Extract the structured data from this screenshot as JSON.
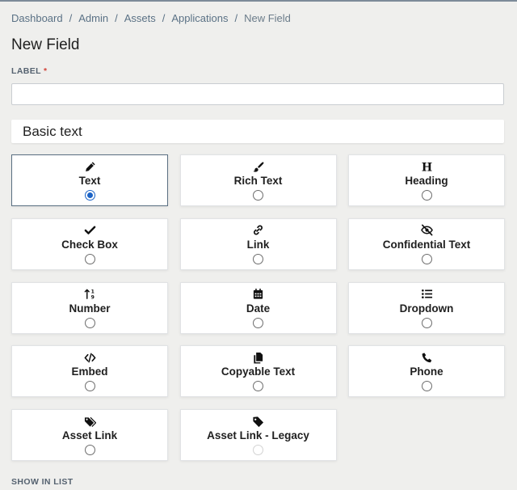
{
  "breadcrumb": {
    "items": [
      "Dashboard",
      "Admin",
      "Assets",
      "Applications"
    ],
    "current": "New Field",
    "separator": "/"
  },
  "page": {
    "title": "New Field"
  },
  "label_field": {
    "label": "LABEL",
    "required_mark": "*",
    "value": ""
  },
  "section": {
    "title": "Basic text"
  },
  "field_types": [
    {
      "label": "Text",
      "icon": "pencil-icon",
      "selected": true,
      "disabled": false
    },
    {
      "label": "Rich Text",
      "icon": "brush-icon",
      "selected": false,
      "disabled": false
    },
    {
      "label": "Heading",
      "icon": "heading-icon",
      "selected": false,
      "disabled": false
    },
    {
      "label": "Check Box",
      "icon": "checkmark-icon",
      "selected": false,
      "disabled": false
    },
    {
      "label": "Link",
      "icon": "link-icon",
      "selected": false,
      "disabled": false
    },
    {
      "label": "Confidential Text",
      "icon": "eye-slash-icon",
      "selected": false,
      "disabled": false
    },
    {
      "label": "Number",
      "icon": "sort-numeric-icon",
      "selected": false,
      "disabled": false
    },
    {
      "label": "Date",
      "icon": "calendar-icon",
      "selected": false,
      "disabled": false
    },
    {
      "label": "Dropdown",
      "icon": "list-icon",
      "selected": false,
      "disabled": false
    },
    {
      "label": "Embed",
      "icon": "code-icon",
      "selected": false,
      "disabled": false
    },
    {
      "label": "Copyable Text",
      "icon": "copy-icon",
      "selected": false,
      "disabled": false
    },
    {
      "label": "Phone",
      "icon": "phone-icon",
      "selected": false,
      "disabled": false
    },
    {
      "label": "Asset Link",
      "icon": "tags-icon",
      "selected": false,
      "disabled": false
    },
    {
      "label": "Asset Link - Legacy",
      "icon": "tag-icon",
      "selected": false,
      "disabled": true
    }
  ],
  "show_in_list": {
    "label": "SHOW IN LIST"
  },
  "colors": {
    "background": "#efefed",
    "breadcrumb": "#5a7185",
    "radio_checked": "#1b63c6",
    "required": "#d2453b",
    "selected_border": "#5a6f82"
  }
}
